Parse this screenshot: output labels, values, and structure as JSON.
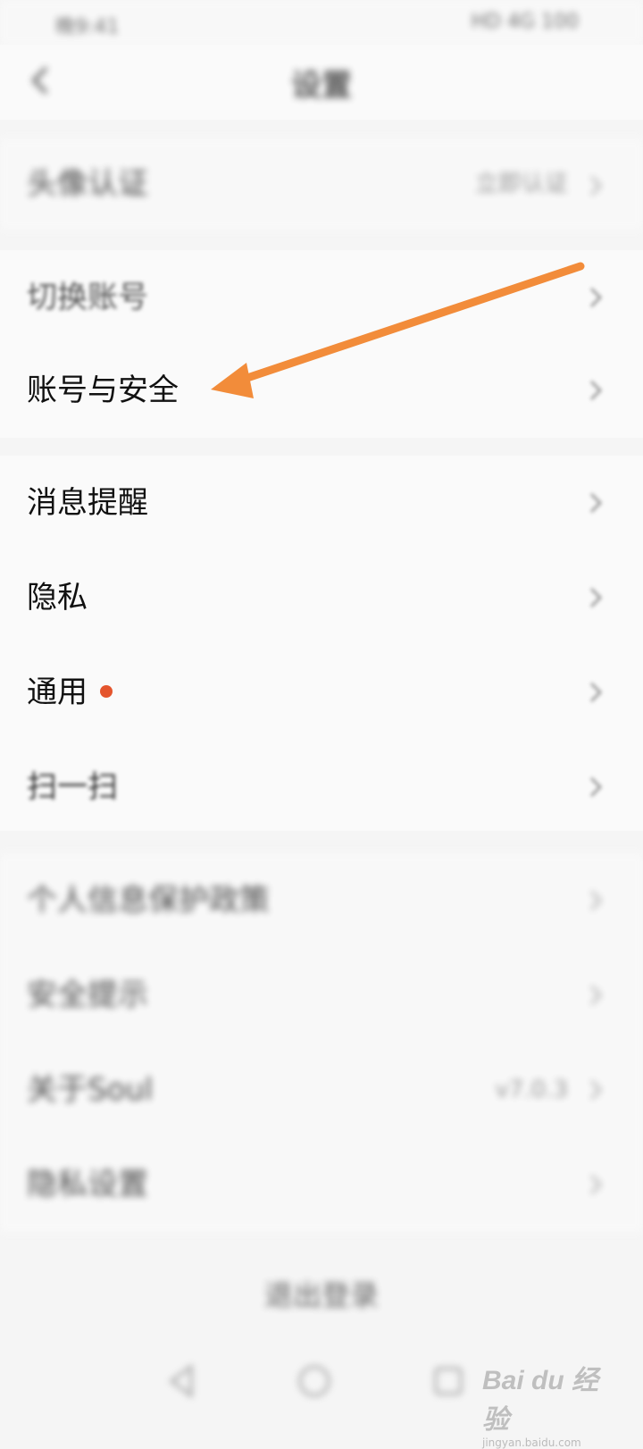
{
  "status_bar": {
    "time": "晚9:41",
    "right": "HD 4G 100"
  },
  "header": {
    "title": "设置"
  },
  "sections": [
    {
      "rows": [
        {
          "label": "头像认证",
          "value": "立即认证"
        }
      ]
    },
    {
      "rows": [
        {
          "label": "切换账号"
        },
        {
          "label": "账号与安全"
        }
      ]
    },
    {
      "rows": [
        {
          "label": "消息提醒"
        },
        {
          "label": "隐私"
        },
        {
          "label": "通用",
          "badge": true
        },
        {
          "label": "扫一扫"
        }
      ]
    },
    {
      "rows": [
        {
          "label": "个人信息保护政策"
        },
        {
          "label": "安全提示"
        },
        {
          "label": "关于Soul",
          "value": "v7.0.3"
        },
        {
          "label": "隐私设置"
        }
      ]
    }
  ],
  "logout_label": "退出登录",
  "watermark": {
    "brand": "Bai du 经验",
    "sub": "jingyan.baidu.com"
  },
  "colors": {
    "accent_arrow": "#f28c3a",
    "badge_dot": "#e4552d",
    "background": "#f5f5f5"
  }
}
